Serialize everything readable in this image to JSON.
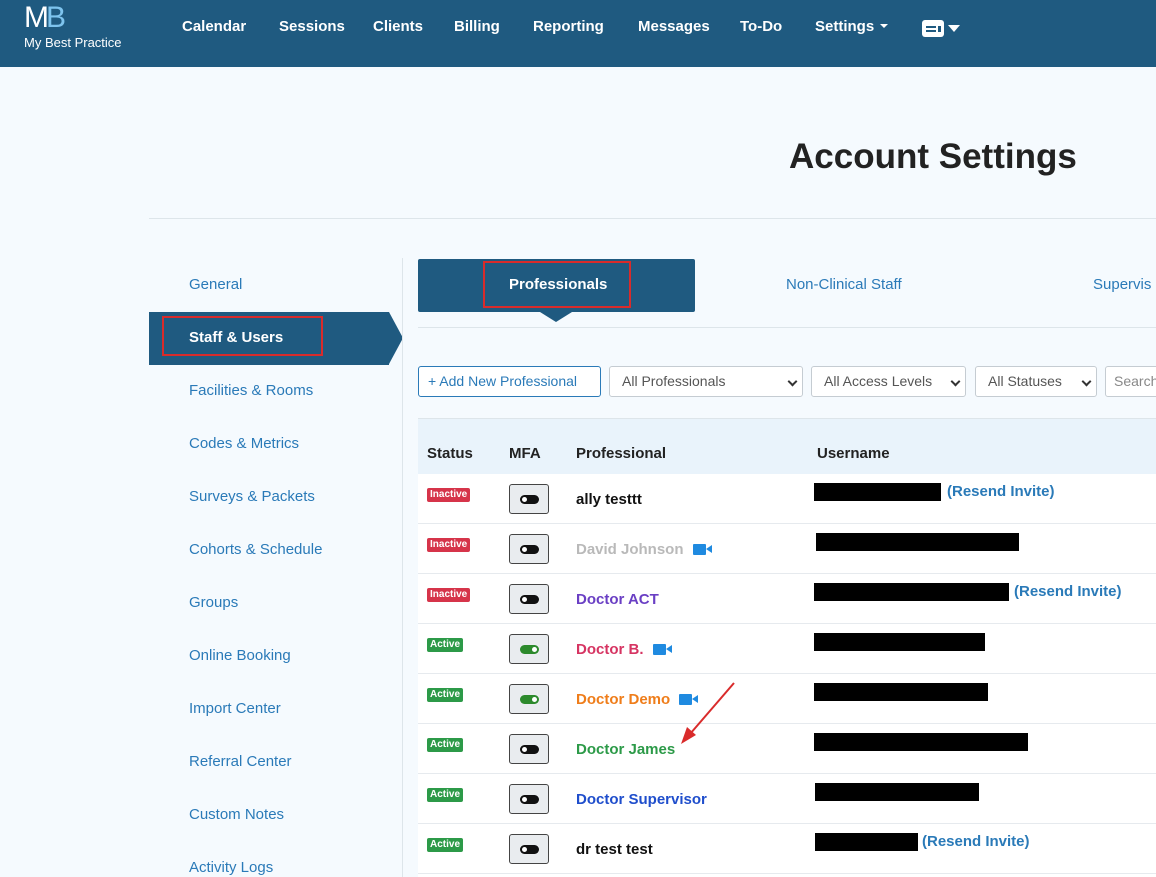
{
  "brand": {
    "mark_m": "M",
    "mark_b": "B",
    "name": "My Best Practice"
  },
  "nav": {
    "items": [
      "Calendar",
      "Sessions",
      "Clients",
      "Billing",
      "Reporting",
      "Messages",
      "To-Do",
      "Settings"
    ]
  },
  "page": {
    "title": "Account Settings"
  },
  "sidebar": {
    "items": [
      "General",
      "Staff & Users",
      "Facilities & Rooms",
      "Codes & Metrics",
      "Surveys & Packets",
      "Cohorts & Schedule",
      "Groups",
      "Online Booking",
      "Import Center",
      "Referral Center",
      "Custom Notes",
      "Activity Logs"
    ],
    "active": "Staff & Users"
  },
  "tabs": [
    "Professionals",
    "Non-Clinical Staff",
    "Supervis"
  ],
  "filters": {
    "add_label": "+ Add New Professional",
    "professionals": "All Professionals",
    "access_levels": "All Access Levels",
    "statuses": "All Statuses",
    "search_placeholder": "Search"
  },
  "table": {
    "columns": [
      "Status",
      "MFA",
      "Professional",
      "Username"
    ],
    "rows": [
      {
        "status": "Inactive",
        "mfa": false,
        "name": "ally testtt",
        "color": "#111111",
        "video": false,
        "resend": "(Resend Invite)"
      },
      {
        "status": "Inactive",
        "mfa": false,
        "name": "David Johnson",
        "color": "#b9b9b9",
        "video": true,
        "resend": ""
      },
      {
        "status": "Inactive",
        "mfa": false,
        "name": "Doctor ACT",
        "color": "#6a3fc4",
        "video": false,
        "resend": "(Resend Invite)"
      },
      {
        "status": "Active",
        "mfa": true,
        "name": "Doctor B.",
        "color": "#d63462",
        "video": true,
        "resend": ""
      },
      {
        "status": "Active",
        "mfa": true,
        "name": "Doctor Demo",
        "color": "#ef7d1a",
        "video": true,
        "resend": ""
      },
      {
        "status": "Active",
        "mfa": false,
        "name": "Doctor James",
        "color": "#2c9a48",
        "video": false,
        "resend": ""
      },
      {
        "status": "Active",
        "mfa": false,
        "name": "Doctor Supervisor",
        "color": "#1f4ecc",
        "video": false,
        "resend": ""
      },
      {
        "status": "Active",
        "mfa": false,
        "name": "dr test test",
        "color": "#111111",
        "video": false,
        "resend": "(Resend Invite)"
      }
    ]
  },
  "colors": {
    "primary": "#1f5a80",
    "link": "#2a7ab8",
    "highlight": "#d92b2b",
    "inactive": "#d6344a",
    "active": "#2c9a48"
  },
  "icons": {
    "video": "video-camera-icon",
    "account": "id-card-icon",
    "annotation": "red-arrow-annotation"
  }
}
